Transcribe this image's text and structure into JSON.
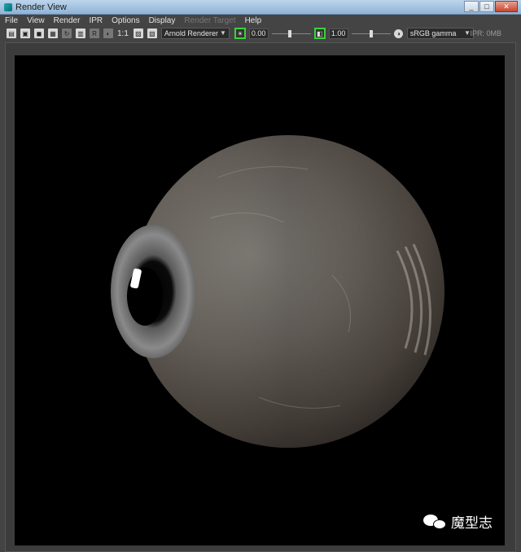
{
  "window": {
    "title": "Render View",
    "minimize": "_",
    "maximize": "□",
    "close": "✕"
  },
  "menu": {
    "items": [
      "File",
      "View",
      "Render",
      "IPR",
      "Options",
      "Display",
      "Render Target",
      "Help"
    ],
    "disabled": [
      "Render Target"
    ]
  },
  "toolbar": {
    "ratio_label": "1:1",
    "renderer": "Arnold Renderer",
    "exposure_value": "0.00",
    "exposure_level": 0.45,
    "gamma_value": "1.00",
    "gamma_level": 0.5,
    "color_space": "sRGB gamma",
    "ipr_status": "IPR: 0MB"
  },
  "watermark": {
    "text": "魔型志"
  }
}
